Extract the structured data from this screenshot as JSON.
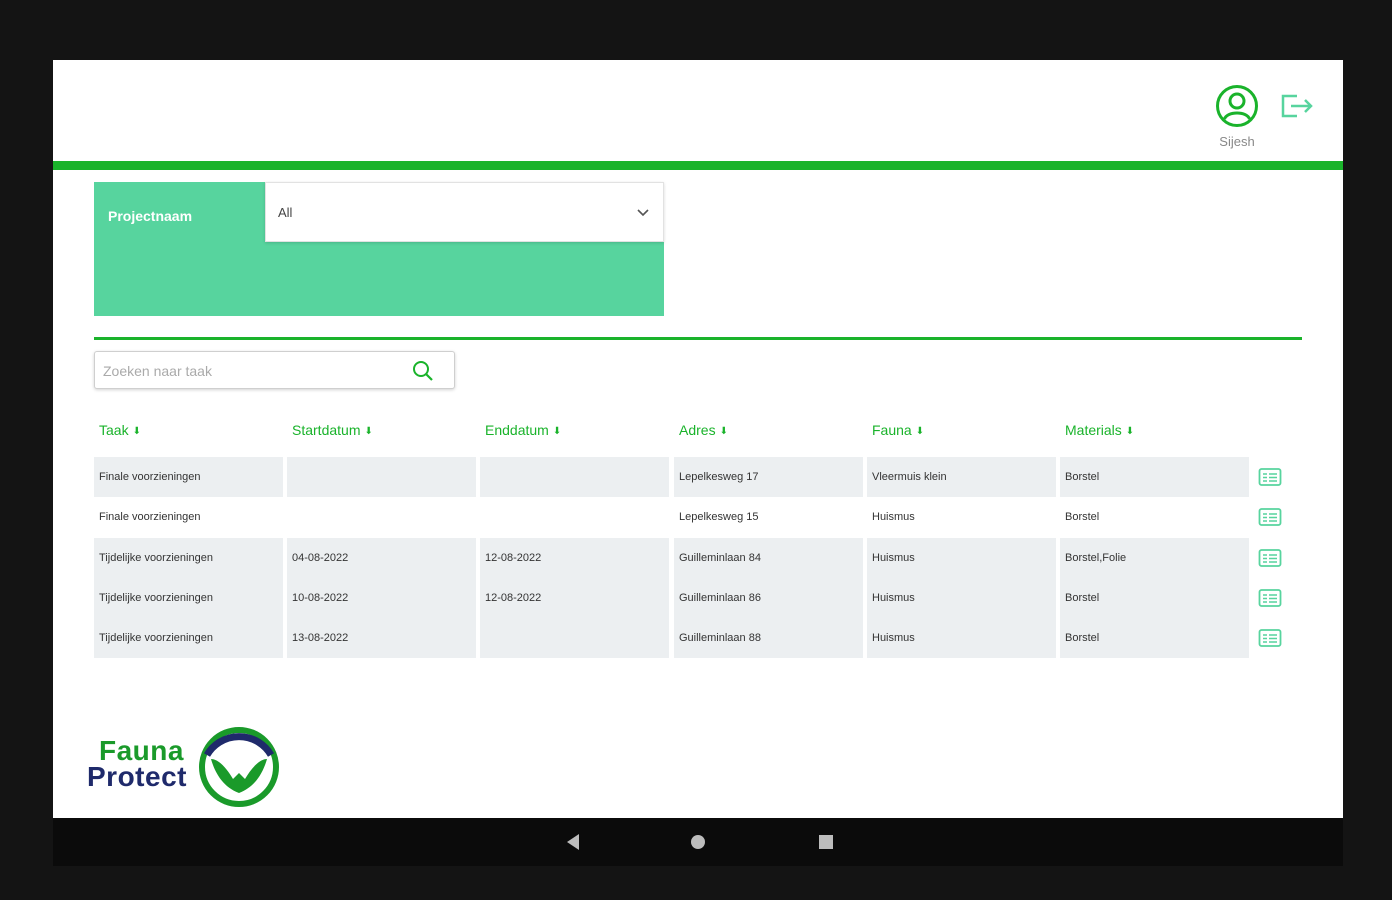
{
  "header": {
    "user_name": "Sijesh",
    "user_icon": "user-circle-icon",
    "logout_icon": "logout-icon"
  },
  "filter": {
    "label": "Projectnaam",
    "selected": "All"
  },
  "search": {
    "placeholder": "Zoeken naar taak",
    "value": ""
  },
  "table": {
    "sort_indicator": "⬇",
    "columns": [
      "Taak",
      "Startdatum",
      "Enddatum",
      "Adres",
      "Fauna",
      "Materials"
    ],
    "rows": [
      [
        "Finale voorzieningen",
        "",
        "",
        "Lepelkesweg 17",
        "Vleermuis klein",
        "Borstel"
      ],
      [
        "Finale voorzieningen",
        "",
        "",
        "Lepelkesweg 15",
        "Huismus",
        "Borstel"
      ],
      [
        "Tijdelijke voorzieningen",
        "04-08-2022",
        "12-08-2022",
        "Guilleminlaan 84",
        "Huismus",
        "Borstel,Folie"
      ],
      [
        "Tijdelijke voorzieningen",
        "10-08-2022",
        "12-08-2022",
        "Guilleminlaan 86",
        "Huismus",
        "Borstel"
      ],
      [
        "Tijdelijke voorzieningen",
        "13-08-2022",
        "",
        "Guilleminlaan 88",
        "Huismus",
        "Borstel"
      ]
    ]
  },
  "logo": {
    "line1": "Fauna",
    "line2": "Protect"
  },
  "colors": {
    "accent": "#1ab32b",
    "filter_panel": "#57d49e",
    "row_shade": "#eceff1"
  }
}
